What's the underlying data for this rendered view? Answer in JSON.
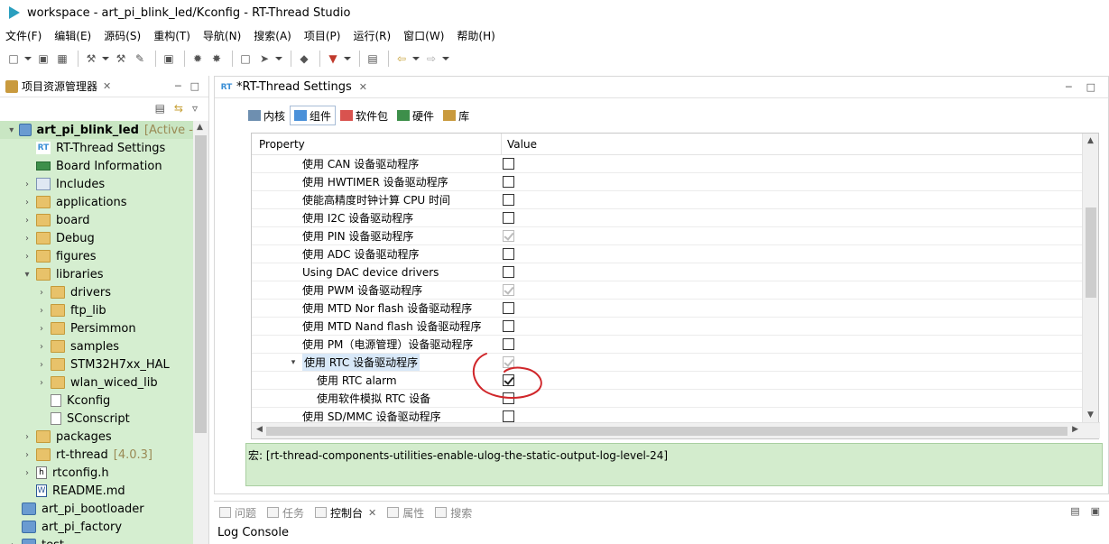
{
  "window": {
    "title": "workspace - art_pi_blink_led/Kconfig - RT-Thread Studio"
  },
  "menubar": [
    "文件(F)",
    "编辑(E)",
    "源码(S)",
    "重构(T)",
    "导航(N)",
    "搜索(A)",
    "项目(P)",
    "运行(R)",
    "窗口(W)",
    "帮助(H)"
  ],
  "explorer": {
    "tab_label": "项目资源管理器",
    "tree": [
      {
        "label": "art_pi_blink_led",
        "annot": "[Active -",
        "icon": "project",
        "level": 0,
        "twisty": "▾",
        "bold": true,
        "selected": true
      },
      {
        "label": "RT-Thread Settings",
        "icon": "rt",
        "level": 1,
        "twisty": ""
      },
      {
        "label": "Board Information",
        "icon": "board",
        "level": 1,
        "twisty": ""
      },
      {
        "label": "Includes",
        "icon": "inc",
        "level": 1,
        "twisty": "›"
      },
      {
        "label": "applications",
        "icon": "folder",
        "level": 1,
        "twisty": "›"
      },
      {
        "label": "board",
        "icon": "folder",
        "level": 1,
        "twisty": "›"
      },
      {
        "label": "Debug",
        "icon": "folder",
        "level": 1,
        "twisty": "›"
      },
      {
        "label": "figures",
        "icon": "folder",
        "level": 1,
        "twisty": "›"
      },
      {
        "label": "libraries",
        "icon": "folder",
        "level": 1,
        "twisty": "▾"
      },
      {
        "label": "drivers",
        "icon": "folder",
        "level": 2,
        "twisty": "›"
      },
      {
        "label": "ftp_lib",
        "icon": "folder",
        "level": 2,
        "twisty": "›"
      },
      {
        "label": "Persimmon",
        "icon": "folder",
        "level": 2,
        "twisty": "›"
      },
      {
        "label": "samples",
        "icon": "folder",
        "level": 2,
        "twisty": "›"
      },
      {
        "label": "STM32H7xx_HAL",
        "icon": "folder",
        "level": 2,
        "twisty": "›"
      },
      {
        "label": "wlan_wiced_lib",
        "icon": "folder",
        "level": 2,
        "twisty": "›"
      },
      {
        "label": "Kconfig",
        "icon": "file",
        "level": 2,
        "twisty": ""
      },
      {
        "label": "SConscript",
        "icon": "file",
        "level": 2,
        "twisty": ""
      },
      {
        "label": "packages",
        "icon": "folder",
        "level": 1,
        "twisty": "›"
      },
      {
        "label": "rt-thread",
        "annot": "[4.0.3]",
        "icon": "folder",
        "level": 1,
        "twisty": "›"
      },
      {
        "label": "rtconfig.h",
        "icon": "h",
        "level": 1,
        "twisty": "›"
      },
      {
        "label": "README.md",
        "icon": "w",
        "level": 1,
        "twisty": ""
      },
      {
        "label": "art_pi_bootloader",
        "icon": "project",
        "level": 0,
        "twisty": ""
      },
      {
        "label": "art_pi_factory",
        "icon": "project",
        "level": 0,
        "twisty": ""
      },
      {
        "label": "test",
        "icon": "project",
        "level": 0,
        "twisty": "›"
      }
    ]
  },
  "editor": {
    "tab_label": "*RT-Thread Settings",
    "subtabs": [
      {
        "label": "内核",
        "active": false,
        "color": "#6e8fb0"
      },
      {
        "label": "组件",
        "active": true,
        "color": "#4a90d9"
      },
      {
        "label": "软件包",
        "active": false,
        "color": "#d9534f"
      },
      {
        "label": "硬件",
        "active": false,
        "color": "#3d8f4a"
      },
      {
        "label": "库",
        "active": false,
        "color": "#c99a3e"
      }
    ],
    "grid": {
      "col_property": "Property",
      "col_value": "Value",
      "rows": [
        {
          "name": "使用 CAN 设备驱动程序",
          "level": 1,
          "checked": false,
          "disabled": false
        },
        {
          "name": "使用 HWTIMER 设备驱动程序",
          "level": 1,
          "checked": false,
          "disabled": false
        },
        {
          "name": "使能高精度时钟计算 CPU 时间",
          "level": 1,
          "checked": false,
          "disabled": false
        },
        {
          "name": "使用 I2C 设备驱动程序",
          "level": 1,
          "checked": false,
          "disabled": false
        },
        {
          "name": "使用 PIN 设备驱动程序",
          "level": 1,
          "checked": true,
          "disabled": true
        },
        {
          "name": "使用 ADC 设备驱动程序",
          "level": 1,
          "checked": false,
          "disabled": false
        },
        {
          "name": "Using DAC device drivers",
          "level": 1,
          "checked": false,
          "disabled": false
        },
        {
          "name": "使用 PWM 设备驱动程序",
          "level": 1,
          "checked": true,
          "disabled": true
        },
        {
          "name": "使用 MTD Nor flash 设备驱动程序",
          "level": 1,
          "checked": false,
          "disabled": false
        },
        {
          "name": "使用 MTD Nand flash 设备驱动程序",
          "level": 1,
          "checked": false,
          "disabled": false
        },
        {
          "name": "使用 PM（电源管理）设备驱动程序",
          "level": 1,
          "checked": false,
          "disabled": false
        },
        {
          "name": "使用 RTC 设备驱动程序",
          "level": 1,
          "checked": true,
          "disabled": true,
          "expanded": true,
          "highlight": true
        },
        {
          "name": "使用 RTC alarm",
          "level": 2,
          "checked": true,
          "disabled": false
        },
        {
          "name": "使用软件模拟 RTC 设备",
          "level": 2,
          "checked": false,
          "disabled": false
        },
        {
          "name": "使用 SD/MMC 设备驱动程序",
          "level": 1,
          "checked": false,
          "disabled": false
        }
      ]
    },
    "description": "宏: [rt-thread-components-utilities-enable-ulog-the-static-output-log-level-24]"
  },
  "bottom": {
    "tabs": [
      {
        "label": "问题",
        "active": false
      },
      {
        "label": "任务",
        "active": false
      },
      {
        "label": "控制台",
        "active": true
      },
      {
        "label": "属性",
        "active": false
      },
      {
        "label": "搜索",
        "active": false
      }
    ],
    "console_title": "Log Console"
  },
  "colors": {
    "accent_green": "#d3eccd",
    "selection_blue": "#d8e8f8",
    "annotation_red": "#d0262a"
  }
}
